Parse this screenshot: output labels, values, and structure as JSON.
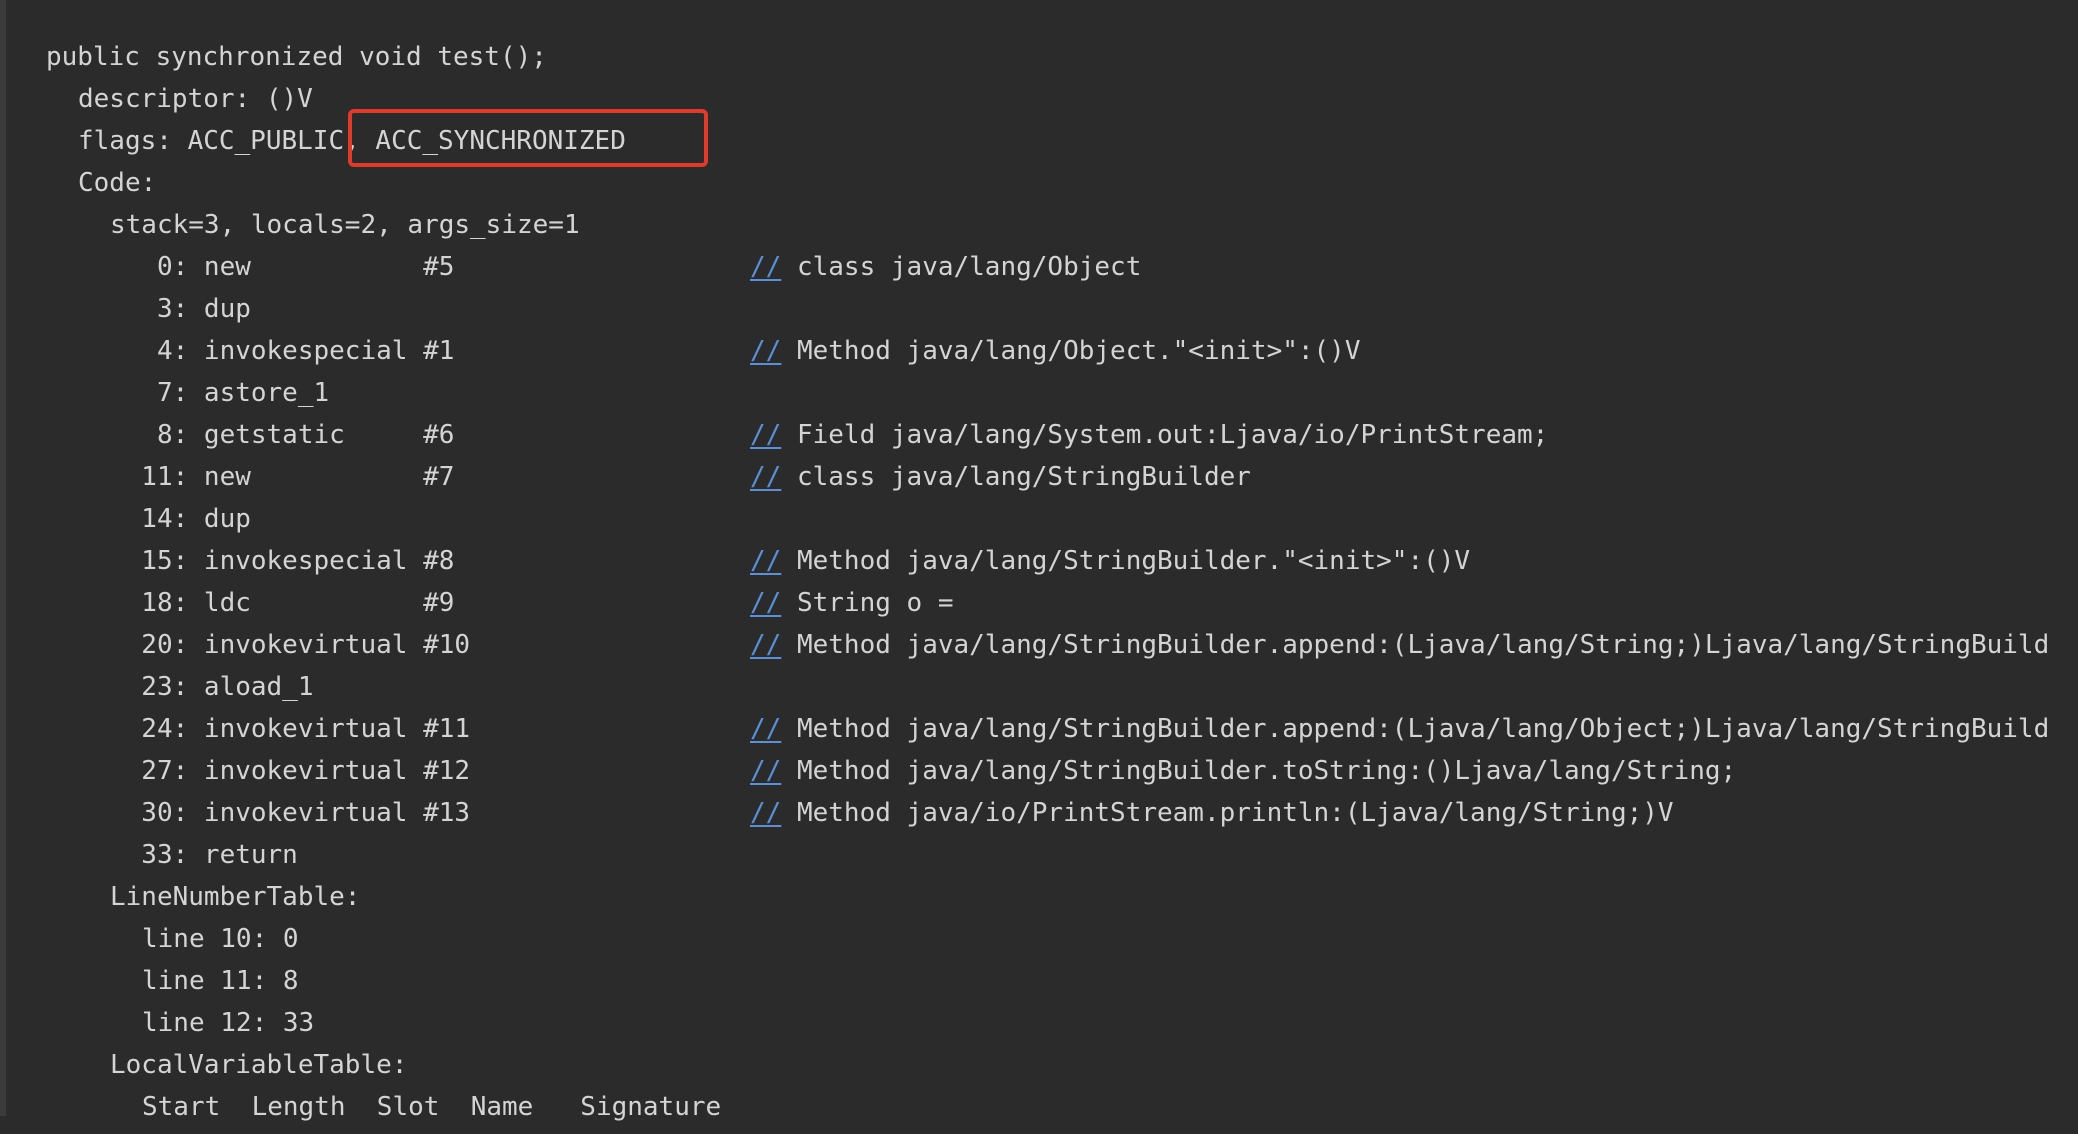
{
  "header": {
    "signature": "public synchronized void test();",
    "descriptor": "descriptor: ()V",
    "flags": "flags: ACC_PUBLIC, ACC_SYNCHRONIZED",
    "code_label": "Code:",
    "stack_info": "stack=3, locals=2, args_size=1"
  },
  "instructions": [
    {
      "text": "   0: new           #5",
      "comment": "class java/lang/Object"
    },
    {
      "text": "   3: dup",
      "comment": ""
    },
    {
      "text": "   4: invokespecial #1",
      "comment": "Method java/lang/Object.\"<init>\":()V"
    },
    {
      "text": "   7: astore_1",
      "comment": ""
    },
    {
      "text": "   8: getstatic     #6",
      "comment": "Field java/lang/System.out:Ljava/io/PrintStream;"
    },
    {
      "text": "  11: new           #7",
      "comment": "class java/lang/StringBuilder"
    },
    {
      "text": "  14: dup",
      "comment": ""
    },
    {
      "text": "  15: invokespecial #8",
      "comment": "Method java/lang/StringBuilder.\"<init>\":()V"
    },
    {
      "text": "  18: ldc           #9",
      "comment": "String o ="
    },
    {
      "text": "  20: invokevirtual #10",
      "comment": "Method java/lang/StringBuilder.append:(Ljava/lang/String;)Ljava/lang/StringBuild"
    },
    {
      "text": "  23: aload_1",
      "comment": ""
    },
    {
      "text": "  24: invokevirtual #11",
      "comment": "Method java/lang/StringBuilder.append:(Ljava/lang/Object;)Ljava/lang/StringBuild"
    },
    {
      "text": "  27: invokevirtual #12",
      "comment": "Method java/lang/StringBuilder.toString:()Ljava/lang/String;"
    },
    {
      "text": "  30: invokevirtual #13",
      "comment": "Method java/io/PrintStream.println:(Ljava/lang/String;)V"
    },
    {
      "text": "  33: return",
      "comment": ""
    }
  ],
  "comment_prefix": "//",
  "line_number_table": {
    "label": "LineNumberTable:",
    "rows": [
      "line 10: 0",
      "line 11: 8",
      "line 12: 33"
    ]
  },
  "local_variable_table": {
    "label": "LocalVariableTable:",
    "header": "Start  Length  Slot  Name   Signature"
  },
  "colors": {
    "background": "#2b2b2b",
    "text": "#d4d4d4",
    "comment_slashes": "#5c8fd6",
    "highlight_border": "#e03a2a"
  }
}
